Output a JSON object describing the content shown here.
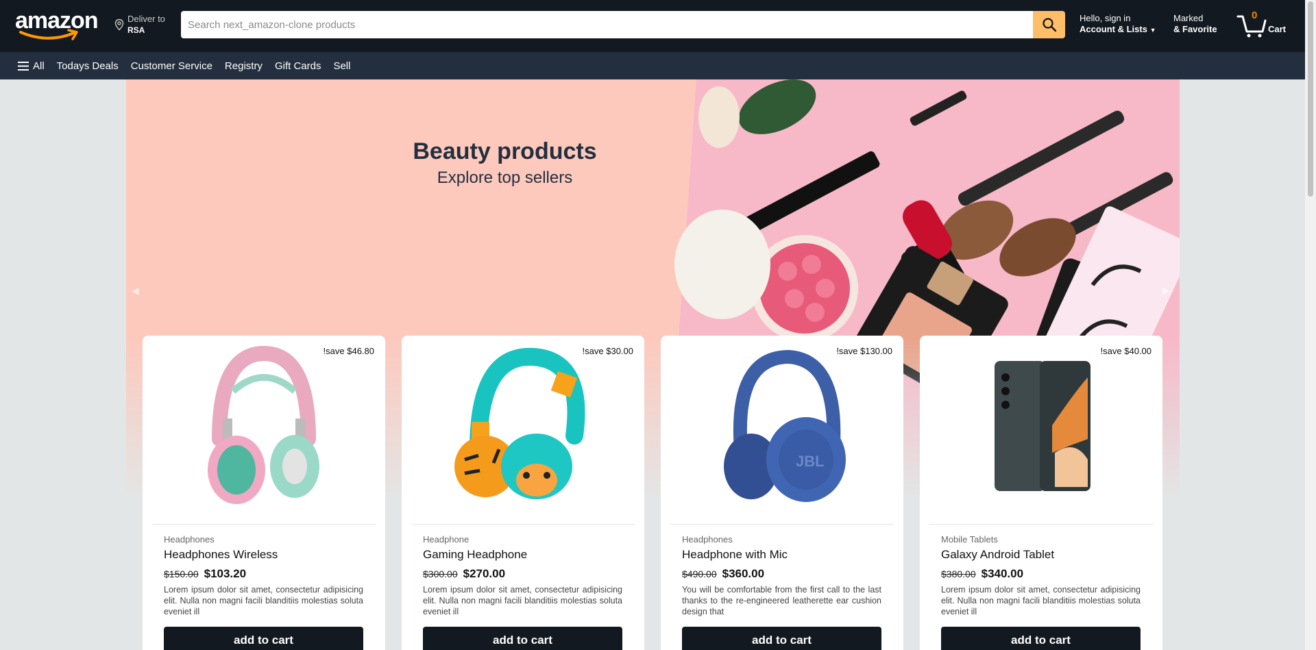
{
  "header": {
    "logo_text": "amazon",
    "deliver_sub": "Deliver to",
    "deliver_main": "RSA",
    "search_placeholder": "Search next_amazon-clone products",
    "account_sub": "Hello, sign in",
    "account_main": "Account & Lists",
    "marked_sub": "Marked",
    "marked_main": "& Favorite",
    "cart_count": "0",
    "cart_label": "Cart"
  },
  "subnav": {
    "items": [
      "All",
      "Todays Deals",
      "Customer Service",
      "Registry",
      "Gift Cards",
      "Sell"
    ]
  },
  "hero": {
    "title": "Beauty products",
    "subtitle": "Explore top sellers"
  },
  "products": [
    {
      "save": "!save $46.80",
      "category": "Headphones",
      "name": "Headphones Wireless",
      "old_price": "$150.00",
      "price": "$103.20",
      "description": "Lorem ipsum dolor sit amet, consectetur adipisicing elit. Nulla non magni facili blanditiis molestias soluta eveniet ill",
      "button": "add to cart",
      "image_icon": "pink-headphones"
    },
    {
      "save": "!save $30.00",
      "category": "Headphone",
      "name": "Gaming Headphone",
      "old_price": "$300.00",
      "price": "$270.00",
      "description": "Lorem ipsum dolor sit amet, consectetur adipisicing elit. Nulla non magni facili blanditiis molestias soluta eveniet ill",
      "button": "add to cart",
      "image_icon": "kids-tiger-headphones"
    },
    {
      "save": "!save $130.00",
      "category": "Headphones",
      "name": "Headphone with Mic",
      "old_price": "$490.00",
      "price": "$360.00",
      "description": "You will be comfortable from the first call to the last thanks to the re-engineered leatherette ear cushion design that",
      "button": "add to cart",
      "image_icon": "blue-jbl-headphones"
    },
    {
      "save": "!save $40.00",
      "category": "Mobile Tablets",
      "name": "Galaxy Android Tablet",
      "old_price": "$380.00",
      "price": "$340.00",
      "description": "Lorem ipsum dolor sit amet, consectetur adipisicing elit. Nulla non magni facili blanditiis molestias soluta eveniet ill",
      "button": "add to cart",
      "image_icon": "foldable-phone"
    }
  ],
  "colors": {
    "header_bg": "#131921",
    "subnav_bg": "#232f3e",
    "search_button": "#febd69",
    "cart_count": "#f08804",
    "hero_bg": "#fdc9bd"
  }
}
